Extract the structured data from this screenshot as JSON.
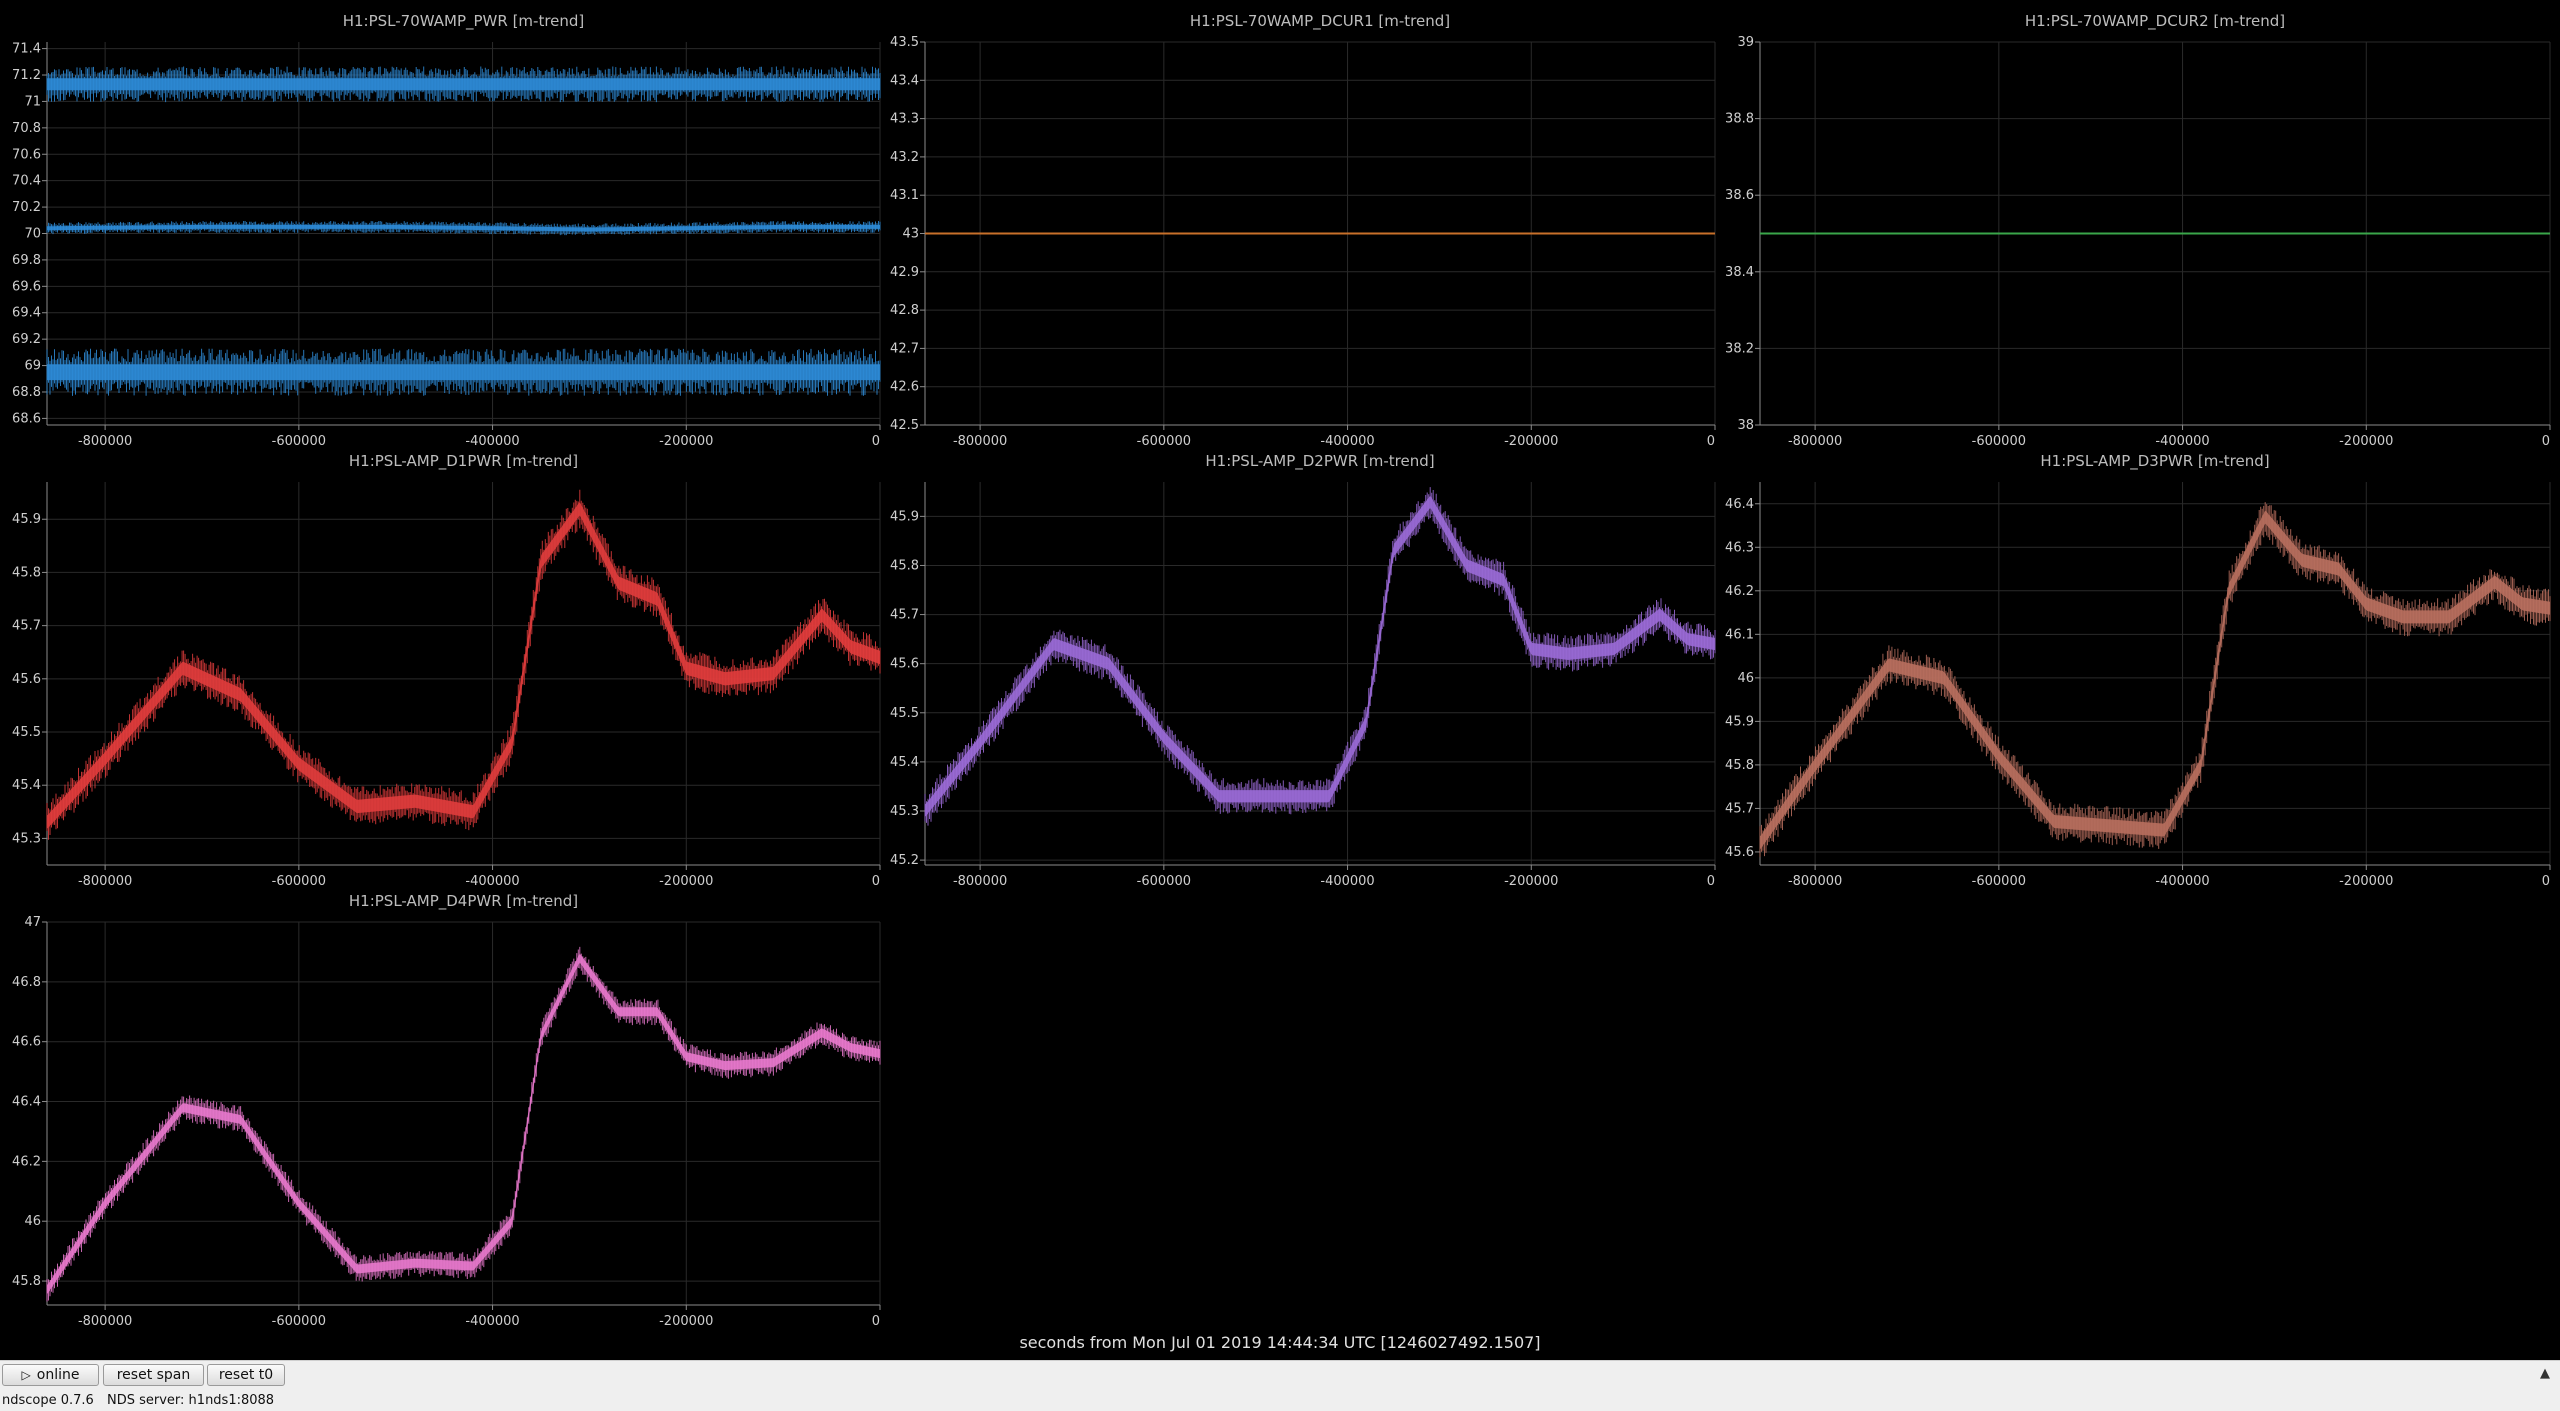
{
  "x_axis_label": "seconds from Mon Jul 01 2019 14:44:34 UTC [1246027492.1507]",
  "toolbar": {
    "online_icon": "play-icon",
    "online_glyph": "▷",
    "online_label": "online",
    "reset_span_label": "reset span",
    "reset_t0_label": "reset t0",
    "collapse_icon": "chevron-up-icon",
    "collapse_glyph": "▲"
  },
  "status": {
    "version": "ndscope 0.7.6",
    "server": "NDS server: h1nds1:8088"
  },
  "colors": {
    "background": "#000000",
    "grid": "#2a2a2a",
    "axis": "#8c8c8c"
  },
  "chart_data": [
    {
      "type": "line",
      "title": "H1:PSL-70WAMP_PWR [m-trend]",
      "color": "#2e8bd6",
      "xlim": [
        -860000,
        0
      ],
      "ylim": [
        68.55,
        71.45
      ],
      "yticks": [
        "68.6",
        "68.8",
        "69",
        "69.2",
        "69.4",
        "69.6",
        "69.8",
        "70",
        "70.2",
        "70.4",
        "70.6",
        "70.8",
        "71",
        "71.2",
        "71.4"
      ],
      "xticks": [
        "-800000",
        "-600000",
        "-400000",
        "-200000",
        "0"
      ],
      "series": [
        {
          "x": [
            -860000,
            0
          ],
          "y": [
            71.13,
            71.13
          ],
          "spread": 0.09
        },
        {
          "x": [
            -860000,
            -700000,
            -500000,
            -300000,
            -100000,
            0
          ],
          "y": [
            70.04,
            70.05,
            70.05,
            70.03,
            70.05,
            70.05
          ],
          "spread": 0.03
        },
        {
          "x": [
            -860000,
            0
          ],
          "y": [
            68.95,
            68.95
          ],
          "spread": 0.12
        }
      ]
    },
    {
      "type": "line",
      "title": "H1:PSL-70WAMP_DCUR1 [m-trend]",
      "color": "#c8702a",
      "xlim": [
        -860000,
        0
      ],
      "ylim": [
        42.5,
        43.5
      ],
      "yticks": [
        "42.5",
        "42.6",
        "42.7",
        "42.8",
        "42.9",
        "43",
        "43.1",
        "43.2",
        "43.3",
        "43.4",
        "43.5"
      ],
      "xticks": [
        "-800000",
        "-600000",
        "-400000",
        "-200000",
        "0"
      ],
      "series": [
        {
          "x": [
            -860000,
            0
          ],
          "y": [
            43,
            43
          ],
          "spread": 0
        }
      ]
    },
    {
      "type": "line",
      "title": "H1:PSL-70WAMP_DCUR2 [m-trend]",
      "color": "#3aa64a",
      "xlim": [
        -860000,
        0
      ],
      "ylim": [
        38,
        39
      ],
      "yticks": [
        "38",
        "38.2",
        "38.4",
        "38.6",
        "38.8",
        "39"
      ],
      "xticks": [
        "-800000",
        "-600000",
        "-400000",
        "-200000",
        "0"
      ],
      "series": [
        {
          "x": [
            -860000,
            0
          ],
          "y": [
            38.5,
            38.5
          ],
          "spread": 0
        }
      ]
    },
    {
      "type": "line",
      "title": "H1:PSL-AMP_D1PWR [m-trend]",
      "color": "#e03c3c",
      "xlim": [
        -860000,
        0
      ],
      "ylim": [
        45.25,
        45.97
      ],
      "yticks": [
        "45.3",
        "45.4",
        "45.5",
        "45.6",
        "45.7",
        "45.8",
        "45.9"
      ],
      "xticks": [
        "-800000",
        "-600000",
        "-400000",
        "-200000",
        "0"
      ],
      "series": [
        {
          "x": [
            -860000,
            -800000,
            -720000,
            -660000,
            -600000,
            -540000,
            -480000,
            -420000,
            -380000,
            -350000,
            -310000,
            -270000,
            -230000,
            -200000,
            -160000,
            -110000,
            -60000,
            -30000,
            0
          ],
          "y": [
            45.33,
            45.45,
            45.62,
            45.57,
            45.44,
            45.36,
            45.37,
            45.35,
            45.48,
            45.82,
            45.92,
            45.78,
            45.75,
            45.62,
            45.6,
            45.61,
            45.72,
            45.66,
            45.64
          ],
          "spread": 0.025
        }
      ]
    },
    {
      "type": "line",
      "title": "H1:PSL-AMP_D2PWR [m-trend]",
      "color": "#9a6ad6",
      "xlim": [
        -860000,
        0
      ],
      "ylim": [
        45.19,
        45.97
      ],
      "yticks": [
        "45.2",
        "45.3",
        "45.4",
        "45.5",
        "45.6",
        "45.7",
        "45.8",
        "45.9"
      ],
      "xticks": [
        "-800000",
        "-600000",
        "-400000",
        "-200000",
        "0"
      ],
      "series": [
        {
          "x": [
            -860000,
            -800000,
            -720000,
            -660000,
            -600000,
            -540000,
            -480000,
            -420000,
            -380000,
            -350000,
            -310000,
            -270000,
            -230000,
            -200000,
            -160000,
            -110000,
            -60000,
            -30000,
            0
          ],
          "y": [
            45.3,
            45.44,
            45.64,
            45.6,
            45.45,
            45.33,
            45.33,
            45.33,
            45.48,
            45.83,
            45.93,
            45.8,
            45.77,
            45.63,
            45.62,
            45.63,
            45.7,
            45.65,
            45.64
          ],
          "spread": 0.025
        }
      ]
    },
    {
      "type": "line",
      "title": "H1:PSL-AMP_D3PWR [m-trend]",
      "color": "#b86f5e",
      "xlim": [
        -860000,
        0
      ],
      "ylim": [
        45.57,
        46.45
      ],
      "yticks": [
        "45.6",
        "45.7",
        "45.8",
        "45.9",
        "46",
        "46.1",
        "46.2",
        "46.3",
        "46.4"
      ],
      "xticks": [
        "-800000",
        "-600000",
        "-400000",
        "-200000",
        "0"
      ],
      "series": [
        {
          "x": [
            -860000,
            -800000,
            -720000,
            -660000,
            -600000,
            -540000,
            -480000,
            -420000,
            -380000,
            -350000,
            -310000,
            -270000,
            -230000,
            -200000,
            -160000,
            -110000,
            -60000,
            -30000,
            0
          ],
          "y": [
            45.62,
            45.8,
            46.03,
            46.0,
            45.82,
            45.67,
            45.66,
            45.65,
            45.8,
            46.2,
            46.37,
            46.27,
            46.25,
            46.17,
            46.14,
            46.14,
            46.22,
            46.17,
            46.16
          ],
          "spread": 0.03
        }
      ]
    },
    {
      "type": "line",
      "title": "H1:PSL-AMP_D4PWR [m-trend]",
      "color": "#e878cc",
      "xlim": [
        -860000,
        0
      ],
      "ylim": [
        45.72,
        47.0
      ],
      "yticks": [
        "45.8",
        "46",
        "46.2",
        "46.4",
        "46.6",
        "46.8",
        "47"
      ],
      "xticks": [
        "-800000",
        "-600000",
        "-400000",
        "-200000",
        "0"
      ],
      "series": [
        {
          "x": [
            -860000,
            -800000,
            -720000,
            -660000,
            -600000,
            -540000,
            -480000,
            -420000,
            -380000,
            -350000,
            -310000,
            -270000,
            -230000,
            -200000,
            -160000,
            -110000,
            -60000,
            -30000,
            0
          ],
          "y": [
            45.77,
            46.06,
            46.38,
            46.34,
            46.06,
            45.84,
            45.86,
            45.85,
            46.0,
            46.62,
            46.88,
            46.7,
            46.7,
            46.55,
            46.52,
            46.53,
            46.63,
            46.58,
            46.56
          ],
          "spread": 0.03
        }
      ]
    }
  ]
}
